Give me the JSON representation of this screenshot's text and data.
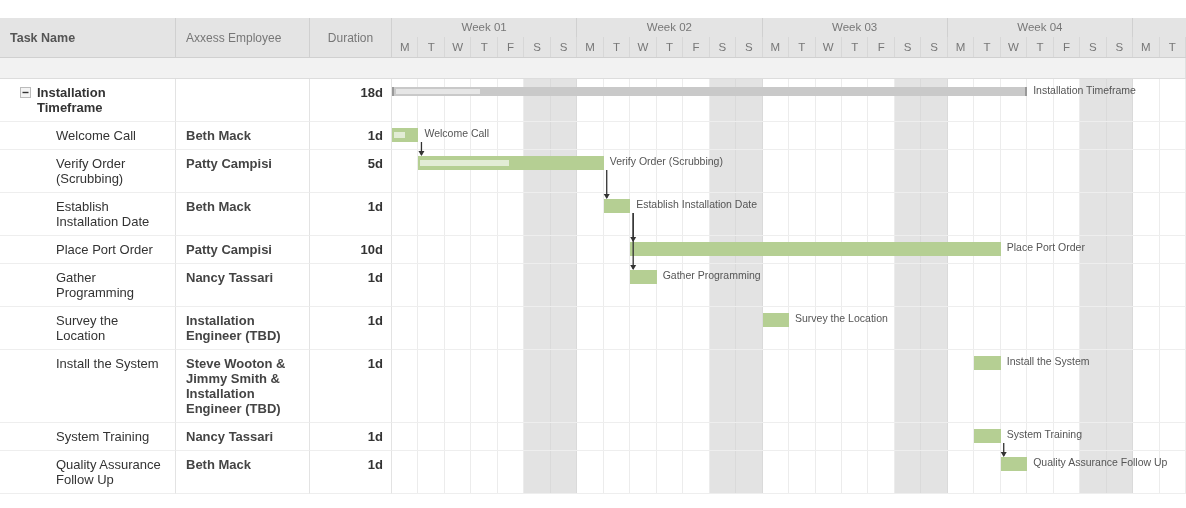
{
  "columns": {
    "task": "Task Name",
    "employee": "Axxess Employee",
    "duration": "Duration"
  },
  "weeks": [
    "Week 01",
    "Week 02",
    "Week 03",
    "Week 04"
  ],
  "days": [
    {
      "label": "M",
      "weekend": false
    },
    {
      "label": "T",
      "weekend": false
    },
    {
      "label": "W",
      "weekend": false
    },
    {
      "label": "T",
      "weekend": false
    },
    {
      "label": "F",
      "weekend": false
    },
    {
      "label": "S",
      "weekend": true
    },
    {
      "label": "S",
      "weekend": true
    },
    {
      "label": "M",
      "weekend": false
    },
    {
      "label": "T",
      "weekend": false
    },
    {
      "label": "W",
      "weekend": false
    },
    {
      "label": "T",
      "weekend": false
    },
    {
      "label": "F",
      "weekend": false
    },
    {
      "label": "S",
      "weekend": true
    },
    {
      "label": "S",
      "weekend": true
    },
    {
      "label": "M",
      "weekend": false
    },
    {
      "label": "T",
      "weekend": false
    },
    {
      "label": "W",
      "weekend": false
    },
    {
      "label": "T",
      "weekend": false
    },
    {
      "label": "F",
      "weekend": false
    },
    {
      "label": "S",
      "weekend": true
    },
    {
      "label": "S",
      "weekend": true
    },
    {
      "label": "M",
      "weekend": false
    },
    {
      "label": "T",
      "weekend": false
    },
    {
      "label": "W",
      "weekend": false
    },
    {
      "label": "T",
      "weekend": false
    },
    {
      "label": "F",
      "weekend": false
    },
    {
      "label": "S",
      "weekend": true
    },
    {
      "label": "S",
      "weekend": true
    },
    {
      "label": "M",
      "weekend": false
    },
    {
      "label": "T",
      "weekend": false
    }
  ],
  "tasks": [
    {
      "kind": "summary",
      "name": "Installation Timeframe",
      "expanded": true,
      "duration": "18d",
      "bar": {
        "level": 0.14,
        "label": "Installation Timeframe"
      },
      "children": [
        {
          "kind": "task",
          "name": "Welcome Call",
          "employee": "Beth Mack",
          "duration": "1d",
          "bar": {
            "level": 0.55,
            "label": "Welcome Call"
          }
        },
        {
          "kind": "task",
          "name": "Verify Order (Scrubbing)",
          "employee": "Patty Campisi",
          "duration": "5d",
          "bar": {
            "level": 0.5,
            "label": "Verify Order (Scrubbing)"
          }
        },
        {
          "kind": "task",
          "name": "Establish Installation Date",
          "employee": "Beth Mack",
          "duration": "1d",
          "bar": {
            "label": "Establish Installation Date"
          }
        },
        {
          "kind": "task",
          "name": "Place Port Order",
          "employee": "Patty Campisi",
          "duration": "10d",
          "bar": {
            "label": "Place Port Order"
          }
        },
        {
          "kind": "task",
          "name": "Gather Programming",
          "employee": "Nancy Tassari",
          "duration": "1d",
          "bar": {
            "label": "Gather Programming"
          }
        },
        {
          "kind": "task",
          "name": "Survey the Location",
          "employee": "Installation Engineer (TBD)",
          "duration": "1d",
          "bar": {
            "label": "Survey the Location"
          }
        },
        {
          "kind": "task",
          "name": "Install the System",
          "employee": "Steve Wooton & Jimmy Smith & Installation Engineer (TBD)",
          "duration": "1d",
          "bar": {
            "label": "Install the System"
          }
        },
        {
          "kind": "task",
          "name": "System Training",
          "employee": "Nancy Tassari",
          "duration": "1d",
          "bar": {
            "label": "System Training"
          }
        },
        {
          "kind": "task",
          "name": "Quality Assurance Follow Up",
          "employee": "Beth Mack",
          "duration": "1d",
          "bar": {
            "label": "Quality Assurance Follow Up"
          }
        }
      ]
    }
  ]
}
